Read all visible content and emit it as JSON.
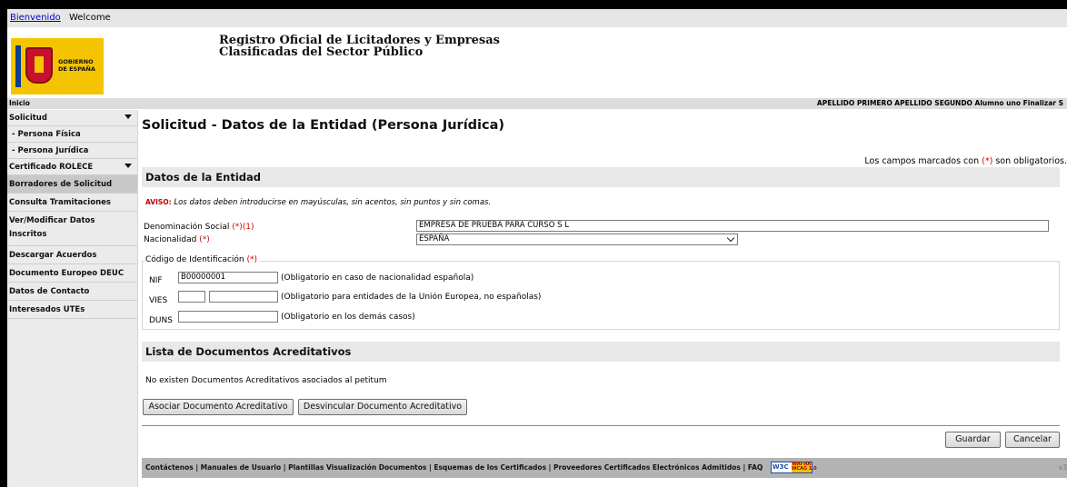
{
  "topbar": {
    "welcome_es": "Bienvenido",
    "welcome_en": "Welcome"
  },
  "header": {
    "logo_text_1": "GOBIERNO",
    "logo_text_2": "DE ESPAÑA",
    "title_line1": "Registro Oficial de Licitadores y Empresas",
    "title_line2": "Clasificadas del Sector Público"
  },
  "navbar": {
    "home": "Inicio",
    "user_info": "APELLIDO PRIMERO APELLIDO SEGUNDO Alumno uno Finalizar S"
  },
  "sidebar": {
    "solicitud": "Solicitud",
    "persona_fisica": "- Persona Física",
    "persona_juridica": "- Persona Jurídica",
    "certificado": "Certificado ROLECE",
    "borradores": "Borradores de Solicitud",
    "consulta": "Consulta Tramitaciones",
    "ver_modificar_1": "Ver/Modificar Datos",
    "ver_modificar_2": "Inscritos",
    "descargar": "Descargar Acuerdos",
    "deuc": "Documento Europeo DEUC",
    "contacto": "Datos de Contacto",
    "utes": "Interesados UTEs"
  },
  "main": {
    "page_title": "Solicitud - Datos de la Entidad (Persona Jurídica)",
    "required_note_pre": "Los campos marcados con",
    "required_mark": "(*)",
    "required_note_post": "son obligatorios.",
    "entity_section": "Datos de la Entidad",
    "warning_label": "AVISO:",
    "warning_text": "Los datos deben introducirse en mayúsculas, sin acentos, sin puntos y sin comas.",
    "denominacion_label": "Denominación Social",
    "denominacion_req": "(*)(1)",
    "denominacion_value": "EMPRESA DE PRUEBA PARA CURSO S L",
    "nacionalidad_label": "Nacionalidad",
    "nacionalidad_req": "(*)",
    "nacionalidad_value": "ESPAÑA",
    "codigo_label": "Código de Identificación",
    "codigo_req": "(*)",
    "nif_label": "NIF",
    "nif_value": "B00000001",
    "nif_hint": "(Obligatorio en caso de nacionalidad española)",
    "vies_label": "VIES",
    "vies_hint": "(Obligatorio para entidades de la Unión Europea, no españolas)",
    "duns_label": "DUNS",
    "duns_hint": "(Obligatorio en los demás casos)",
    "docs_section": "Lista de Documentos Acreditativos",
    "no_docs": "No existen Documentos Acreditativos asociados al petitum",
    "asociar_btn": "Asociar Documento Acreditativo",
    "desvincular_btn": "Desvincular Documento Acreditativo",
    "guardar_btn": "Guardar",
    "cancelar_btn": "Cancelar"
  },
  "footer": {
    "links": "Contáctenos | Manuales de Usuario | Plantillas Visualización Documentos | Esquemas de los Certificados  |  Proveedores Certificados Electrónicos Admitidos | FAQ",
    "w3c": "W3C",
    "wai": "WAI-AA",
    "wcag": "WCAG 1.0",
    "version": "v3"
  }
}
